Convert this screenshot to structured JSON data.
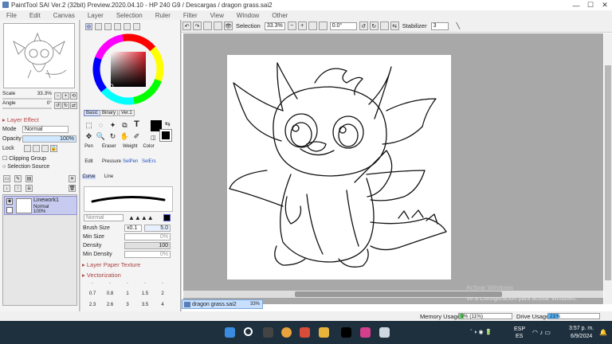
{
  "window": {
    "title": "PaintTool SAI Ver.2 (32bit) Preview.2020.04.10 - HP 240 G9 / Descargas / dragon grass.sai2",
    "min": "—",
    "max": "☐",
    "close": "✕"
  },
  "menu": [
    "File",
    "Edit",
    "Canvas",
    "Layer",
    "Selection",
    "Ruler",
    "Filter",
    "View",
    "Window",
    "Other"
  ],
  "navigator": {
    "scale_label": "Scale",
    "scale_value": "33.3%",
    "angle_label": "Angle",
    "angle_value": "0°"
  },
  "layer_effect": {
    "heading": "Layer Effect",
    "mode_label": "Mode",
    "mode_value": "Normal",
    "opacity_label": "Opacity",
    "opacity_value": "100%",
    "lock_label": "Lock",
    "clipping": "Clipping Group",
    "selection_source": "Selection Source"
  },
  "layers": [
    {
      "name": "Linework1",
      "mode": "Normal",
      "opacity": "100%"
    }
  ],
  "color_tabs": [
    "Basic",
    "Binary",
    "Ver.1"
  ],
  "tools": {
    "row1": [
      "Pen",
      "Eraser",
      "Weight",
      "Color"
    ],
    "row2": [
      "Edit",
      "Pressure",
      "SelPen",
      "SelErs"
    ],
    "row3": [
      "Curve",
      "Line"
    ]
  },
  "brush": {
    "mode": "Normal",
    "size_label": "Brush Size",
    "size_mult": "x0.1",
    "size_value": "5.0",
    "minsize_label": "Min Size",
    "minsize_value": "0%",
    "density_label": "Density",
    "density_value": "100",
    "mindensity_label": "Min Density",
    "mindensity_value": "0%",
    "paper_texture": "Layer Paper Texture",
    "vectorization": "Vectorization"
  },
  "vector_values": [
    ".",
    ".",
    ".",
    ".",
    ".",
    "0.7",
    "0.8",
    "1",
    "1.5",
    "2",
    "2.3",
    "2.6",
    "3",
    "3.5",
    "4"
  ],
  "canvas_toolbar": {
    "selection_label": "Selection",
    "zoom": "33.3%",
    "angle": "0.0°",
    "stabilizer_label": "Stabilizer",
    "stabilizer_value": "3"
  },
  "file_tab": {
    "name": "dragon grass.sai2",
    "zoom": "33%"
  },
  "watermark": {
    "line1": "Activar Windows",
    "line2": "Ve a Configuración para activar Windows."
  },
  "status": {
    "memory_label": "Memory Usage",
    "memory_value": "9% (11%)",
    "memory_pct": 0.09,
    "drive_label": "Drive Usage",
    "drive_value": "21%",
    "drive_pct": 0.21
  },
  "taskbar": {
    "lang": "ESP",
    "lang2": "ES",
    "time": "3:57 p. m.",
    "date": "6/9/2024"
  },
  "colors": {
    "accent": "#d8e0f8",
    "memory_fill": "#6ce06c",
    "drive_fill": "#4fb4ff",
    "taskbar": "#1e2f3e"
  }
}
